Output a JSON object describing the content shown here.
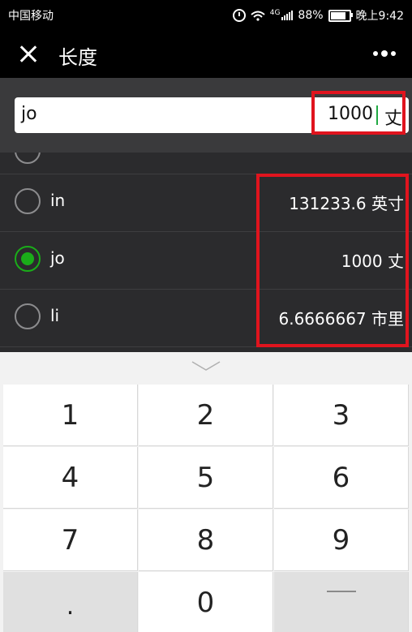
{
  "status_bar": {
    "carrier": "中国移动",
    "network": "4G",
    "battery": "88%",
    "time": "晚上9:42"
  },
  "header": {
    "title": "长度"
  },
  "input": {
    "unit_code": "jo",
    "value": "1000",
    "unit_name": "丈"
  },
  "units": [
    {
      "code": "in",
      "value": "131233.6",
      "unit": "英寸",
      "selected": false
    },
    {
      "code": "jo",
      "value": "1000",
      "unit": "丈",
      "selected": true
    },
    {
      "code": "li",
      "value": "6.6666667",
      "unit": "市里",
      "selected": false
    }
  ],
  "keypad": {
    "keys": [
      "1",
      "2",
      "3",
      "4",
      "5",
      "6",
      "7",
      "8",
      "9",
      ".",
      "0"
    ]
  },
  "colors": {
    "accent": "#1aad19",
    "highlight": "#e0141e",
    "dark_bg": "#2b2b2d"
  }
}
